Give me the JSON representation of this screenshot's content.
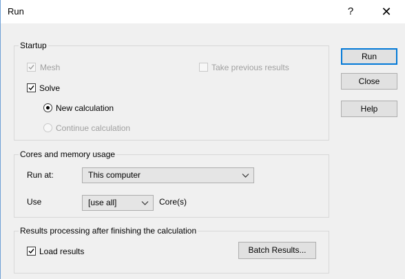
{
  "window": {
    "title": "Run",
    "help_glyph": "?",
    "close_glyph": "✕"
  },
  "startup": {
    "legend": "Startup",
    "mesh": {
      "label": "Mesh",
      "checked": true,
      "enabled": false
    },
    "take_previous": {
      "label": "Take previous results",
      "checked": false,
      "enabled": false
    },
    "solve": {
      "label": "Solve",
      "checked": true
    },
    "new_calc": {
      "label": "New calculation",
      "selected": true
    },
    "continue_calc": {
      "label": "Continue calculation",
      "selected": false,
      "enabled": false
    }
  },
  "cores": {
    "legend": "Cores and memory usage",
    "run_at_label": "Run at:",
    "run_at_value": "This computer",
    "use_label": "Use",
    "use_value": "[use all]",
    "cores_suffix": "Core(s)"
  },
  "results": {
    "legend": "Results processing after finishing the calculation",
    "load_results": {
      "label": "Load results",
      "checked": true
    },
    "batch_button": "Batch Results..."
  },
  "buttons": {
    "run": "Run",
    "close": "Close",
    "help": "Help"
  }
}
